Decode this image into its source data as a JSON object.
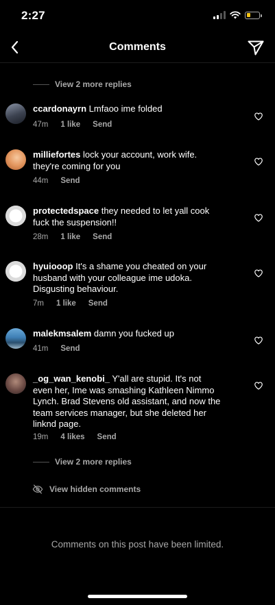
{
  "status": {
    "time": "2:27"
  },
  "nav": {
    "title": "Comments"
  },
  "threads": {
    "top_replies": "View 2 more replies",
    "bottom_replies": "View 2 more replies"
  },
  "comments": [
    {
      "username": "ccardonayrn",
      "text": "Lmfaoo ime folded",
      "time": "47m",
      "likes": "1 like",
      "send": "Send"
    },
    {
      "username": "milliefortes",
      "text": "lock your account, work wife. they're coming for you",
      "time": "44m",
      "send": "Send"
    },
    {
      "username": "protectedspace",
      "text": "they needed to let yall cook fuck the suspension!!",
      "time": "28m",
      "likes": "1 like",
      "send": "Send"
    },
    {
      "username": "hyuiooop",
      "text": "It's a shame you cheated on your husband with your colleague ime udoka. Disgusting behaviour.",
      "time": "7m",
      "likes": "1 like",
      "send": "Send"
    },
    {
      "username": "malekmsalem",
      "text": "damn you fucked up",
      "time": "41m",
      "send": "Send"
    },
    {
      "username": "_og_wan_kenobi_",
      "text": "Y'all are stupid. It's not even her, Ime was smashing Kathleen Nimmo Lynch. Brad Stevens old assistant, and now the team services manager, but she deleted her linknd page.",
      "time": "19m",
      "likes": "4 likes",
      "send": "Send"
    }
  ],
  "hidden": {
    "label": "View hidden comments"
  },
  "footer": {
    "limited": "Comments on this post have been limited."
  },
  "colors": {
    "background": "#000000",
    "secondary_text": "#a8a8a8",
    "battery": "#f5c518"
  },
  "icons": [
    "back-arrow-icon",
    "paper-plane-icon",
    "heart-outline-icon",
    "eye-slash-icon",
    "wifi-icon",
    "signal-icon",
    "battery-icon"
  ],
  "battery_level": 0.35
}
